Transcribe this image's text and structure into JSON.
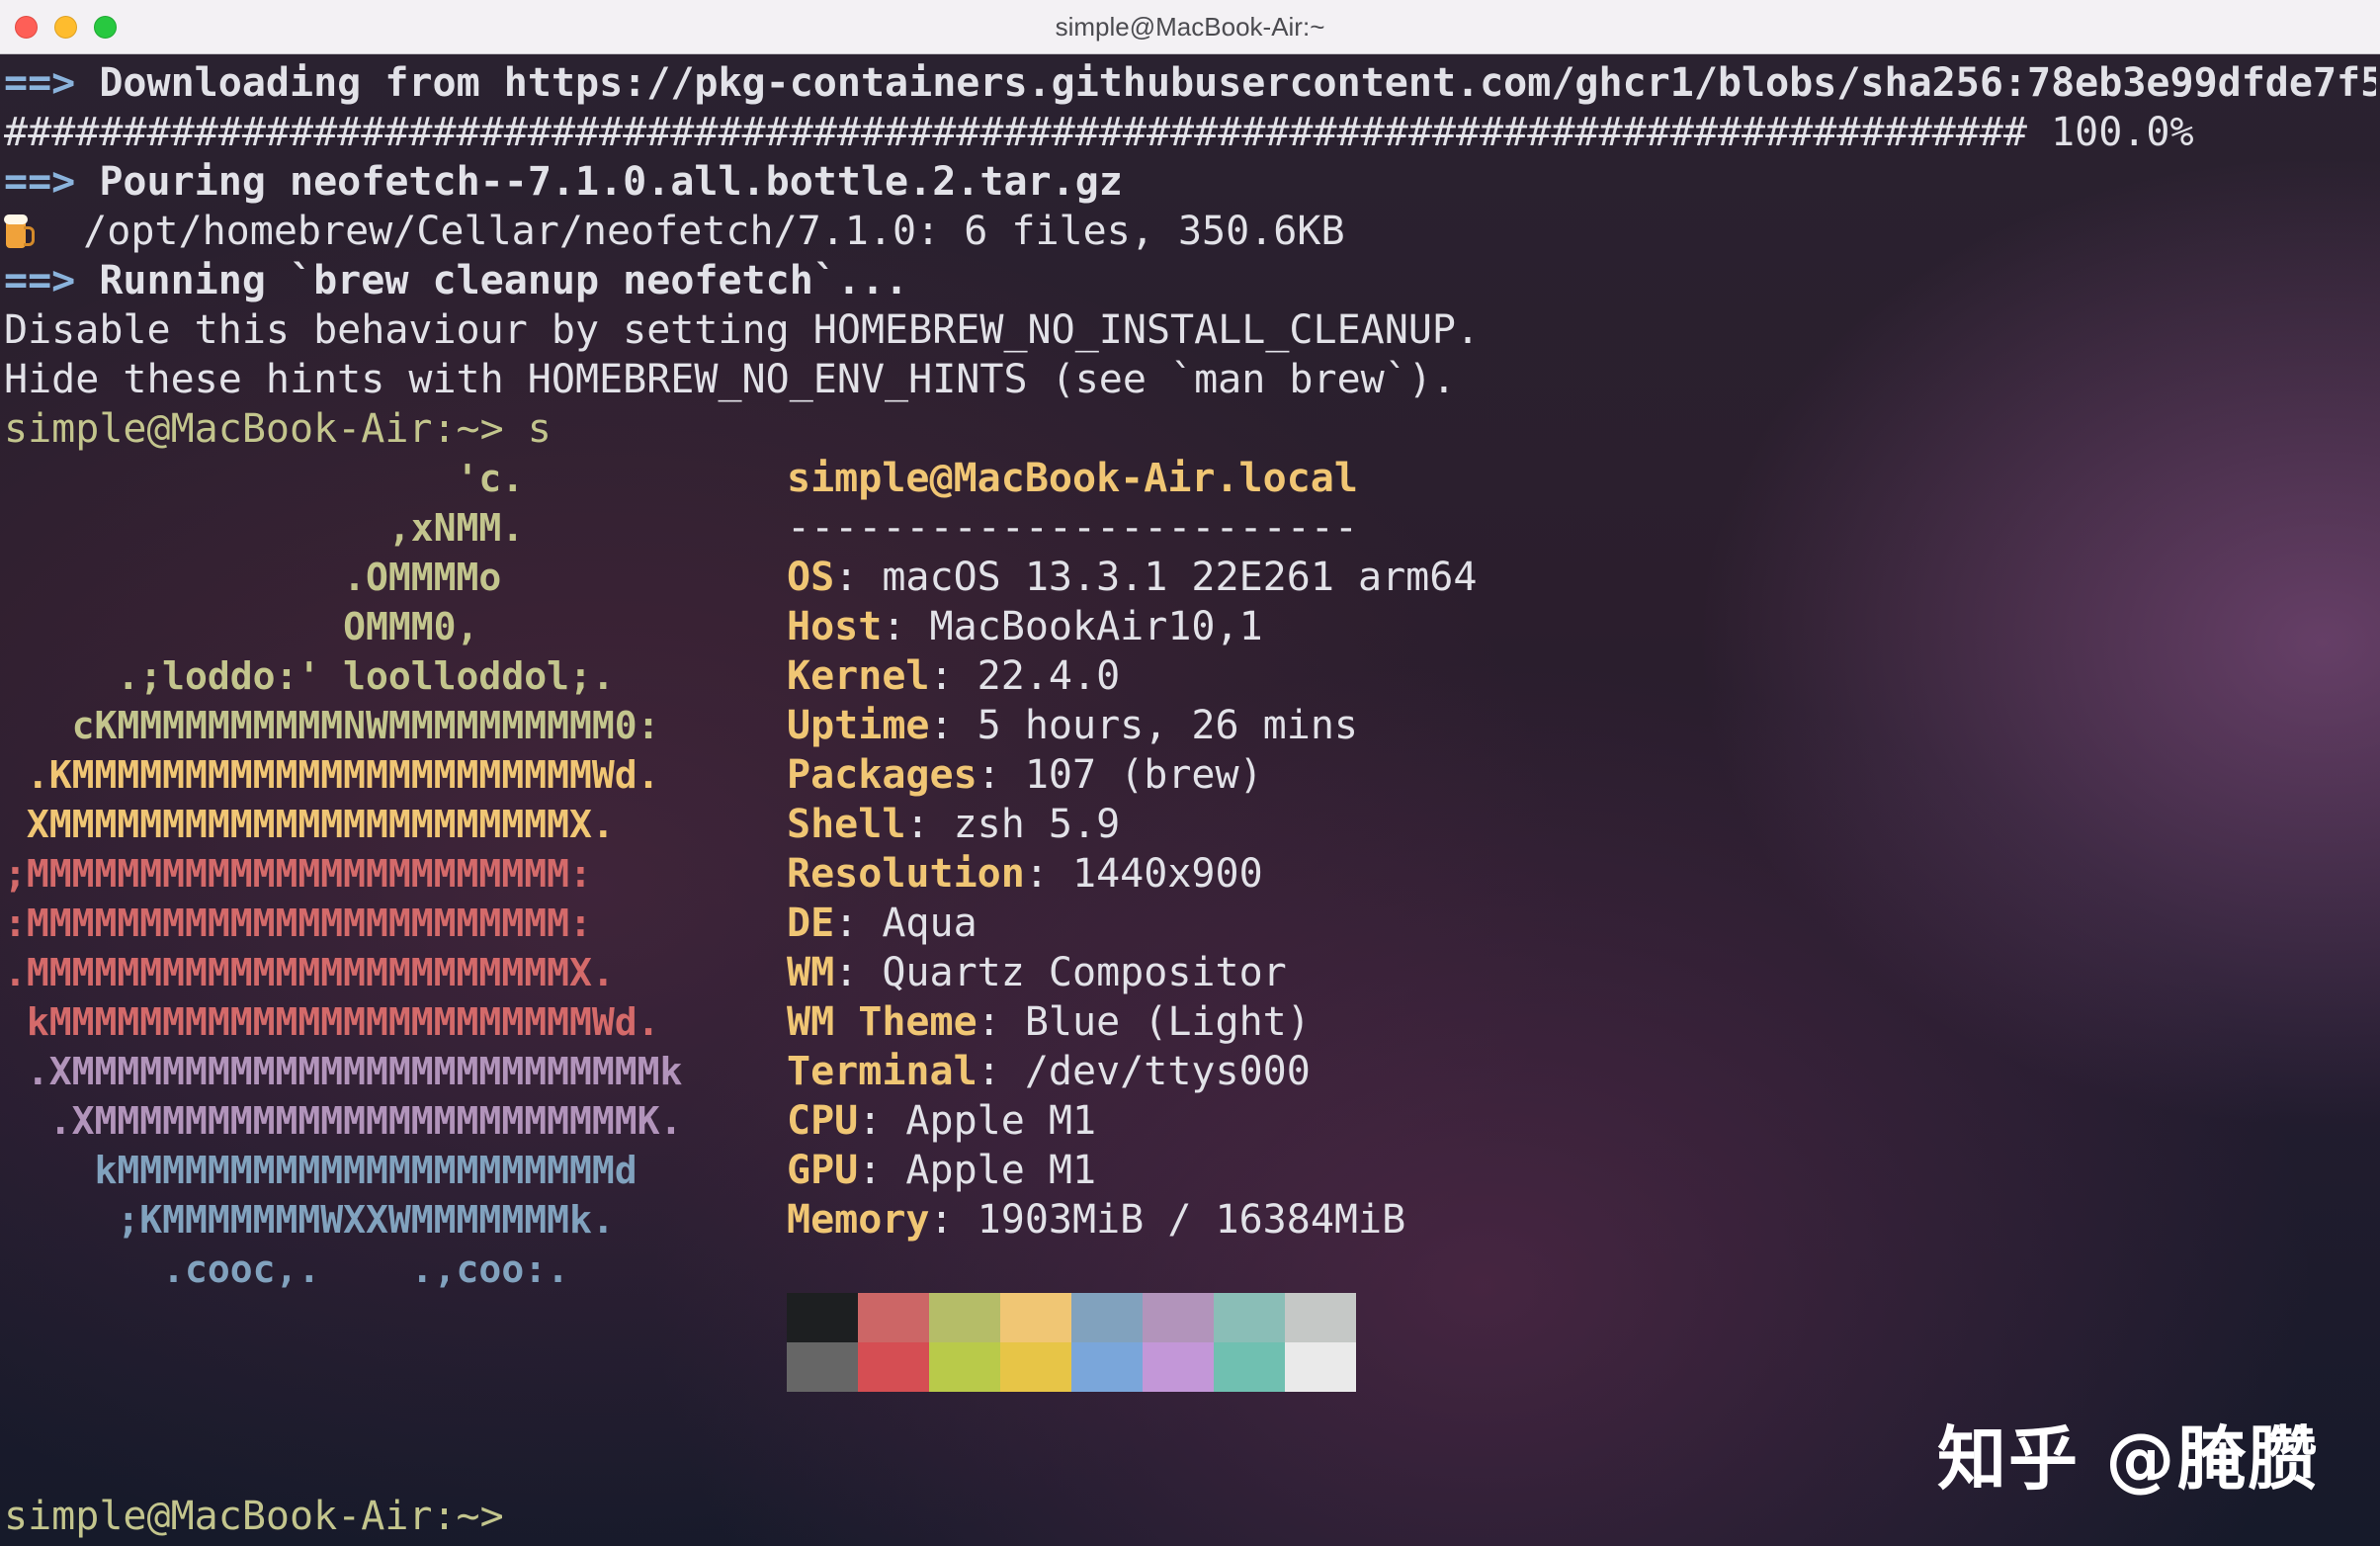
{
  "window": {
    "title": "simple@MacBook-Air:~"
  },
  "terminal": {
    "arrow": "==>",
    "lines": {
      "download_label": "Downloading from https://pkg-containers.githubusercontent.com/ghcr1/blobs/sha256:78eb3e99dfde7f5",
      "progress_bar": "##################################################################################### 100.0%",
      "pour_label": "Pouring neofetch--7.1.0.all.bottle.2.tar.gz",
      "installed_path": "/opt/homebrew/Cellar/neofetch/7.1.0: 6 files, 350.6KB",
      "cleanup_label": "Running `brew cleanup neofetch`...",
      "hint_cleanup": "Disable this behaviour by setting HOMEBREW_NO_INSTALL_CLEANUP.",
      "hint_env": "Hide these hints with HOMEBREW_NO_ENV_HINTS (see `man brew`).",
      "prompt_1": "simple@MacBook-Air:~> s",
      "prompt_2": "simple@MacBook-Air:~>"
    }
  },
  "neofetch": {
    "logo": [
      {
        "text": "                    'c.",
        "color": "#c3c58d"
      },
      {
        "text": "                 ,xNMM.",
        "color": "#c3c58d"
      },
      {
        "text": "               .OMMMMo",
        "color": "#c3c58d"
      },
      {
        "text": "               OMMM0,",
        "color": "#c3c58d"
      },
      {
        "text": "     .;loddo:' loolloddol;.",
        "color": "#c3c58d"
      },
      {
        "text": "   cKMMMMMMMMMMNWMMMMMMMMMM0:",
        "color": "#c3c58d"
      },
      {
        "text": " .KMMMMMMMMMMMMMMMMMMMMMMMWd.",
        "color": "#f0c674"
      },
      {
        "text": " XMMMMMMMMMMMMMMMMMMMMMMMX.",
        "color": "#f0c674"
      },
      {
        "text": ";MMMMMMMMMMMMMMMMMMMMMMMM:",
        "color": "#d46a6a"
      },
      {
        "text": ":MMMMMMMMMMMMMMMMMMMMMMMM:",
        "color": "#d46a6a"
      },
      {
        "text": ".MMMMMMMMMMMMMMMMMMMMMMMMX.",
        "color": "#d46a6a"
      },
      {
        "text": " kMMMMMMMMMMMMMMMMMMMMMMMMWd.",
        "color": "#d46a6a"
      },
      {
        "text": " .XMMMMMMMMMMMMMMMMMMMMMMMMMMk",
        "color": "#b294bb"
      },
      {
        "text": "  .XMMMMMMMMMMMMMMMMMMMMMMMMK.",
        "color": "#b294bb"
      },
      {
        "text": "    kMMMMMMMMMMMMMMMMMMMMMMd",
        "color": "#81a2be"
      },
      {
        "text": "     ;KMMMMMMMWXXWMMMMMMMk.",
        "color": "#81a2be"
      },
      {
        "text": "       .cooc,.    .,coo:.",
        "color": "#81a2be"
      }
    ],
    "header_user": "simple@MacBook-Air.local",
    "separator": "------------------------",
    "info": [
      {
        "key": "OS",
        "value": "macOS 13.3.1 22E261 arm64"
      },
      {
        "key": "Host",
        "value": "MacBookAir10,1"
      },
      {
        "key": "Kernel",
        "value": "22.4.0"
      },
      {
        "key": "Uptime",
        "value": "5 hours, 26 mins"
      },
      {
        "key": "Packages",
        "value": "107 (brew)"
      },
      {
        "key": "Shell",
        "value": "zsh 5.9"
      },
      {
        "key": "Resolution",
        "value": "1440x900"
      },
      {
        "key": "DE",
        "value": "Aqua"
      },
      {
        "key": "WM",
        "value": "Quartz Compositor"
      },
      {
        "key": "WM Theme",
        "value": "Blue (Light)"
      },
      {
        "key": "Terminal",
        "value": "/dev/ttys000"
      },
      {
        "key": "CPU",
        "value": "Apple M1"
      },
      {
        "key": "GPU",
        "value": "Apple M1"
      },
      {
        "key": "Memory",
        "value": "1903MiB / 16384MiB"
      }
    ],
    "palette_normal": [
      "#1d1f21",
      "#cc6666",
      "#b5bd68",
      "#f0c674",
      "#81a2be",
      "#b294bb",
      "#8abeb7",
      "#c5c8c6"
    ],
    "palette_bright": [
      "#666666",
      "#d54e53",
      "#b9ca4a",
      "#e7c547",
      "#7aa6da",
      "#c397d8",
      "#70c0b1",
      "#eaeaea"
    ]
  },
  "watermark": {
    "text": "知乎 @腌臜"
  },
  "icons": {
    "beer": "beer-mug-icon"
  }
}
